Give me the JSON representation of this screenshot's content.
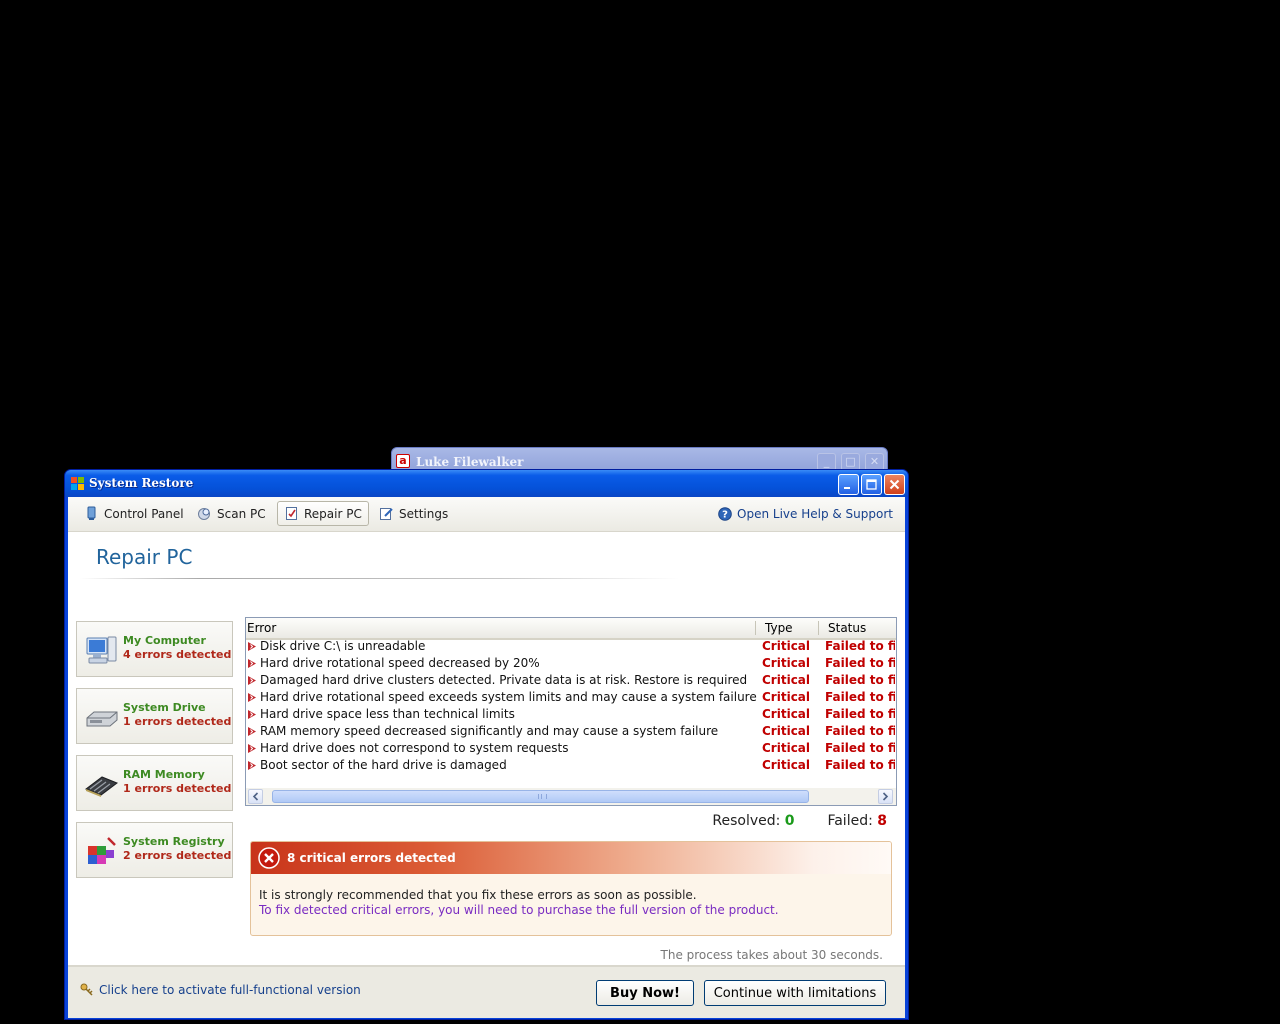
{
  "background_window": {
    "title": "Luke Filewalker"
  },
  "window": {
    "title": "System Restore"
  },
  "toolbar": {
    "tabs": [
      {
        "label": "Control Panel",
        "icon": "control-panel-icon"
      },
      {
        "label": "Scan PC",
        "icon": "scan-icon"
      },
      {
        "label": "Repair PC",
        "icon": "repair-icon",
        "active": true
      },
      {
        "label": "Settings",
        "icon": "settings-icon"
      }
    ],
    "help_label": "Open Live Help & Support"
  },
  "page_title": "Repair PC",
  "categories": [
    {
      "name": "My Computer",
      "errors": "4 errors detected",
      "icon": "computer-icon"
    },
    {
      "name": "System Drive",
      "errors": "1 errors detected",
      "icon": "hard-drive-icon"
    },
    {
      "name": "RAM Memory",
      "errors": "1 errors detected",
      "icon": "ram-icon"
    },
    {
      "name": "System Registry",
      "errors": "2 errors detected",
      "icon": "registry-icon"
    }
  ],
  "error_table": {
    "columns": [
      "Error",
      "Type",
      "Status"
    ],
    "rows": [
      {
        "error": "Disk drive C:\\ is unreadable",
        "type": "Critical",
        "status": "Failed to fix"
      },
      {
        "error": "Hard drive rotational speed decreased by 20%",
        "type": "Critical",
        "status": "Failed to fix"
      },
      {
        "error": "Damaged hard drive clusters detected. Private data is at risk. Restore is required",
        "type": "Critical",
        "status": "Failed to fix"
      },
      {
        "error": "Hard drive rotational speed exceeds system limits and may cause a system failure",
        "type": "Critical",
        "status": "Failed to fix"
      },
      {
        "error": "Hard drive space less than technical limits",
        "type": "Critical",
        "status": "Failed to fix"
      },
      {
        "error": "RAM memory speed decreased significantly and may cause a system failure",
        "type": "Critical",
        "status": "Failed to fix"
      },
      {
        "error": "Hard drive does not correspond to system requests",
        "type": "Critical",
        "status": "Failed to fix"
      },
      {
        "error": "Boot sector of the hard drive is damaged",
        "type": "Critical",
        "status": "Failed to fix"
      }
    ]
  },
  "counts": {
    "resolved_label": "Resolved:",
    "resolved": "0",
    "failed_label": "Failed:",
    "failed": "8"
  },
  "alert": {
    "title": "8 critical errors detected",
    "message": "It is strongly recommended that you fix these errors as soon as possible.",
    "purchase_note": "To fix detected critical errors, you will need to purchase the full version of the product."
  },
  "process_note": "The process takes about 30 seconds.",
  "footer": {
    "activate_label": "Click here to activate full-functional version",
    "buy_label": "Buy Now!",
    "continue_label": "Continue with limitations"
  },
  "colors": {
    "critical": "#c00000",
    "category_name": "#3d8a22",
    "link": "#16408c",
    "resolved": "#1a9a1a",
    "titlebar": "#0551d8"
  }
}
